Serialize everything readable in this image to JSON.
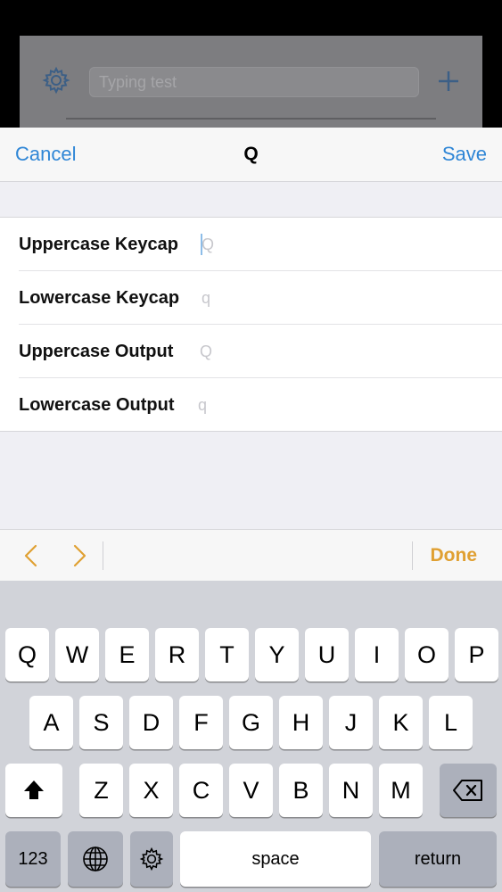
{
  "background": {
    "search_placeholder": "Typing test"
  },
  "navbar": {
    "cancel_label": "Cancel",
    "title": "Q",
    "save_label": "Save"
  },
  "rows": [
    {
      "label": "Uppercase Keycap",
      "value": "",
      "placeholder": "Q"
    },
    {
      "label": "Lowercase Keycap",
      "value": "",
      "placeholder": "q"
    },
    {
      "label": "Uppercase Output",
      "value": "",
      "placeholder": "Q"
    },
    {
      "label": "Lowercase Output",
      "value": "",
      "placeholder": "q"
    }
  ],
  "accessory": {
    "done_label": "Done"
  },
  "keyboard": {
    "row1": [
      "Q",
      "W",
      "E",
      "R",
      "T",
      "Y",
      "U",
      "I",
      "O",
      "P"
    ],
    "row2": [
      "A",
      "S",
      "D",
      "F",
      "G",
      "H",
      "J",
      "K",
      "L"
    ],
    "row3": [
      "Z",
      "X",
      "C",
      "V",
      "B",
      "N",
      "M"
    ],
    "numbers_label": "123",
    "space_label": "space",
    "return_label": "return"
  },
  "colors": {
    "accent_blue": "#2f86d6",
    "accent_orange": "#e0a032"
  }
}
